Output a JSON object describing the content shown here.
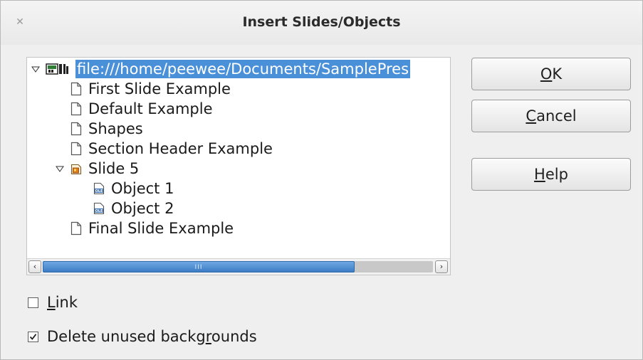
{
  "window": {
    "title": "Insert Slides/Objects",
    "close_glyph": "✕"
  },
  "tree": {
    "root": {
      "label": "file:///home/peewee/Documents/SamplePres",
      "icon": "presentation-icon",
      "expanded": true
    },
    "items": [
      {
        "label": "First Slide Example",
        "icon": "page-icon"
      },
      {
        "label": "Default Example",
        "icon": "page-icon"
      },
      {
        "label": "Shapes",
        "icon": "page-icon"
      },
      {
        "label": "Section Header Example",
        "icon": "page-icon"
      },
      {
        "label": "Slide 5",
        "icon": "slide-objects-icon",
        "expanded": true,
        "children": [
          {
            "label": "Object 1",
            "icon": "ole-object-icon"
          },
          {
            "label": "Object 2",
            "icon": "ole-object-icon"
          }
        ]
      },
      {
        "label": "Final Slide Example",
        "icon": "page-icon"
      }
    ],
    "scrollbar": {
      "left_arrow": "‹",
      "right_arrow": "›",
      "grip": "III",
      "thumb_fraction": 0.8,
      "thumb_position": 0.0
    },
    "ole_badge": "OLE"
  },
  "buttons": {
    "ok": {
      "mnemonic": "O",
      "rest": "K"
    },
    "cancel": {
      "mnemonic": "C",
      "rest": "ancel"
    },
    "help": {
      "mnemonic": "H",
      "rest": "elp"
    }
  },
  "options": {
    "link": {
      "pre": "",
      "mnemonic": "L",
      "post": "ink",
      "checked": false
    },
    "delete_bg": {
      "pre": "Delete unused backg",
      "mnemonic": "r",
      "post": "ounds",
      "checked": true
    }
  },
  "colors": {
    "selection": "#4a90d9",
    "scroll_thumb": "#3c7cc4"
  }
}
